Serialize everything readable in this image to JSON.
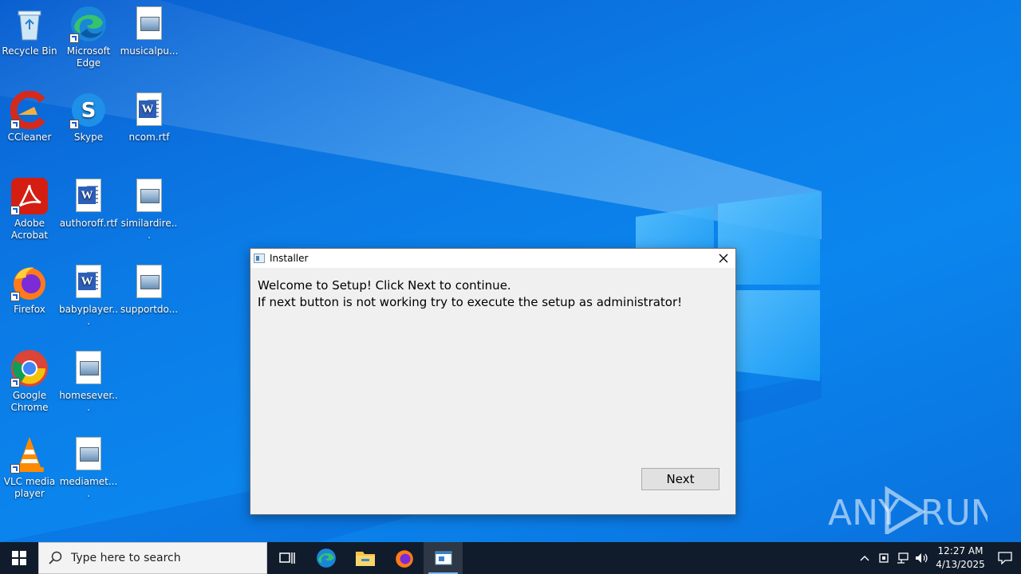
{
  "desktop": {
    "icons": [
      {
        "label": "Recycle Bin"
      },
      {
        "label": "Microsoft Edge"
      },
      {
        "label": "musicalpu..."
      },
      {
        "label": "CCleaner"
      },
      {
        "label": "Skype"
      },
      {
        "label": "ncom.rtf"
      },
      {
        "label": "Adobe Acrobat"
      },
      {
        "label": "authoroff.rtf"
      },
      {
        "label": "similardire..."
      },
      {
        "label": "Firefox"
      },
      {
        "label": "babyplayer..."
      },
      {
        "label": "supportdo..."
      },
      {
        "label": "Google Chrome"
      },
      {
        "label": "homesever..."
      },
      {
        "label": "VLC media player"
      },
      {
        "label": "mediamet...."
      }
    ]
  },
  "dialog": {
    "title": "Installer",
    "line1": "Welcome to Setup! Click Next to continue.",
    "line2": "If next button is not working try to execute the setup as administrator!",
    "next_label": "Next"
  },
  "watermark": {
    "text": "ANY RUN"
  },
  "taskbar": {
    "search_placeholder": "Type here to search",
    "time": "12:27 AM",
    "date": "4/13/2025"
  },
  "colors": {
    "wallpaper": "#0b7be6",
    "taskbar": "#101c2c",
    "dialog_bg": "#f0f0f0"
  }
}
